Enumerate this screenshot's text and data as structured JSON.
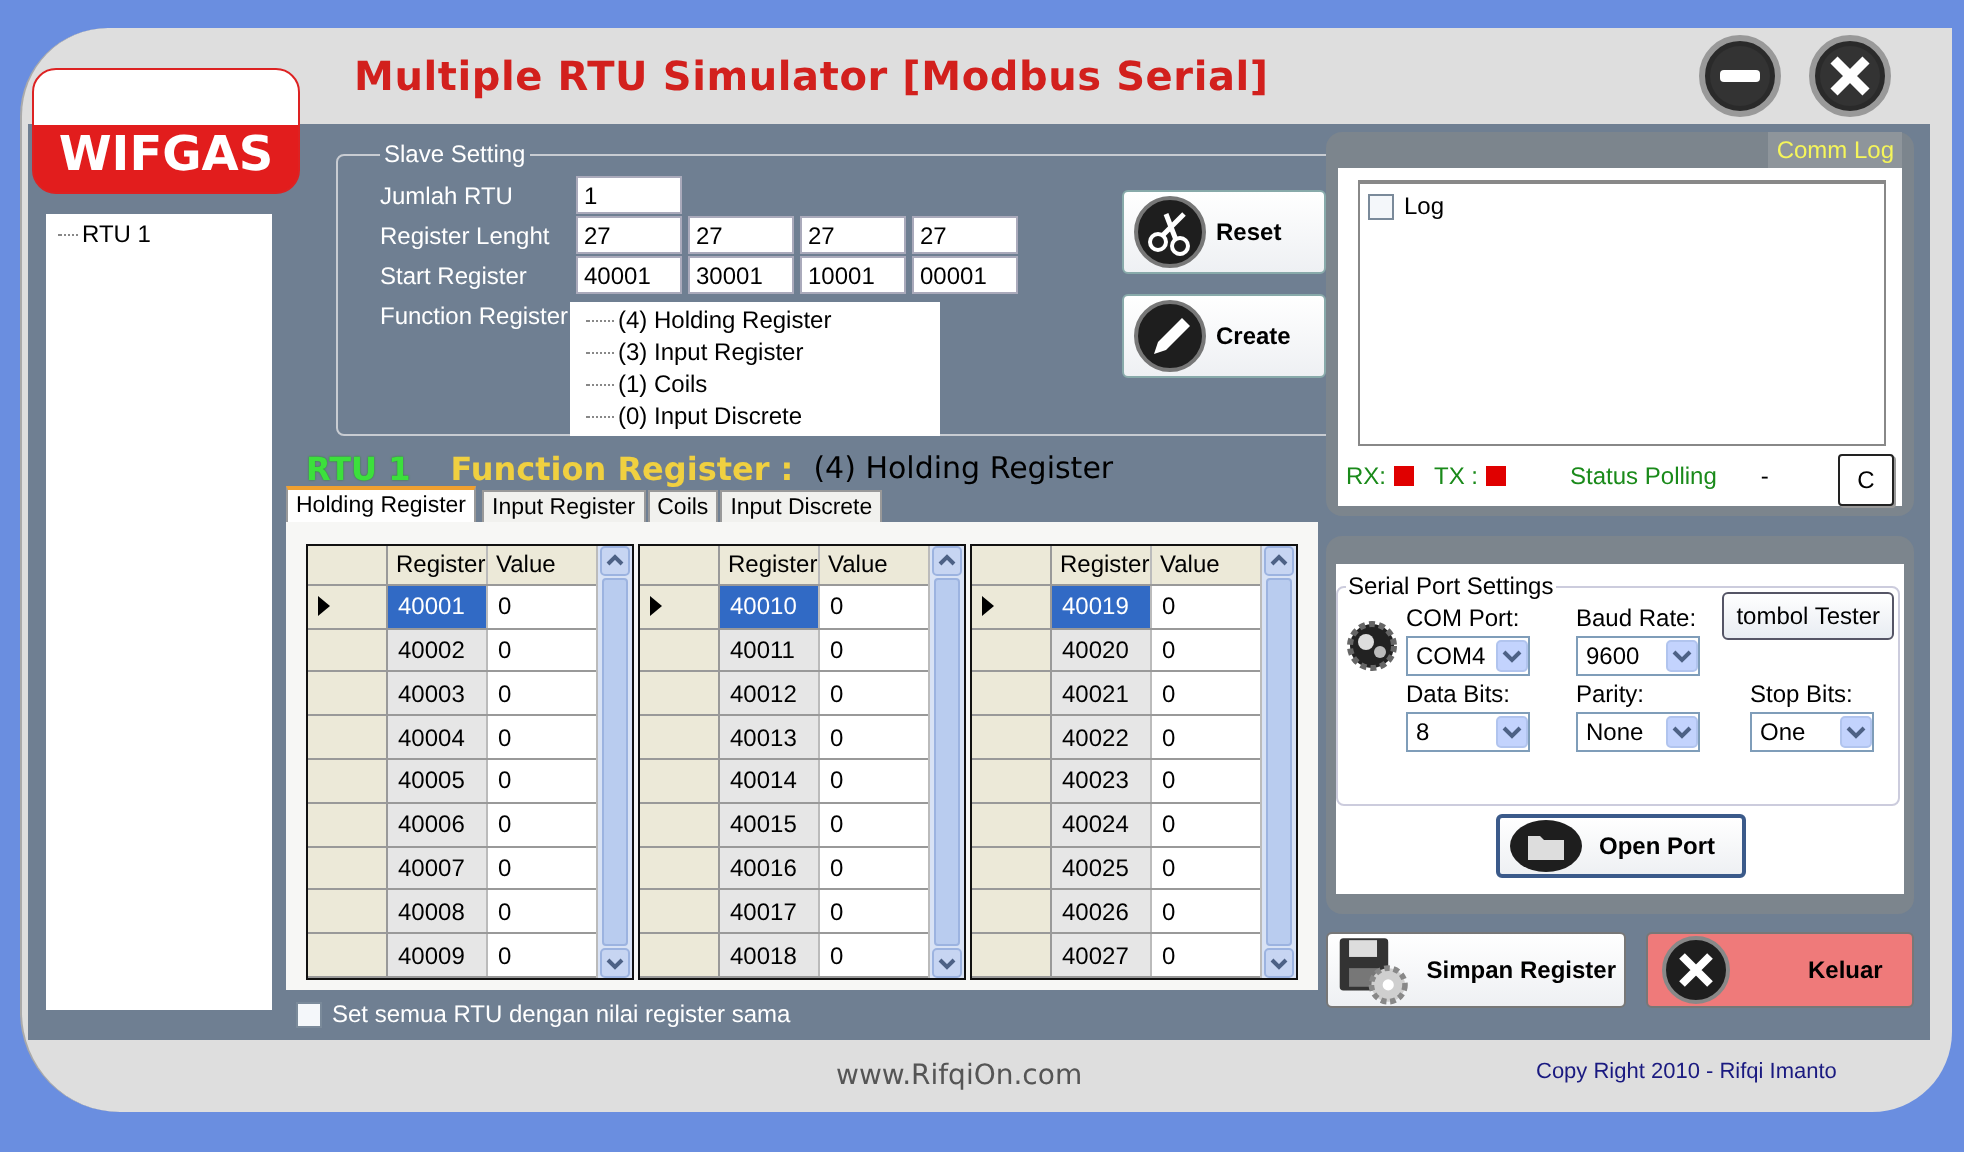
{
  "window": {
    "title": "Multiple RTU Simulator [Modbus Serial]",
    "logo": "WIFGAS"
  },
  "tree": {
    "items": [
      {
        "label": "RTU 1"
      }
    ]
  },
  "slave_setting": {
    "title": "Slave Setting",
    "jumlah_rtu": {
      "label": "Jumlah RTU",
      "value": "1"
    },
    "register_length": {
      "label": "Register Lenght",
      "values": [
        "27",
        "27",
        "27",
        "27"
      ]
    },
    "start_register": {
      "label": "Start Register",
      "values": [
        "40001",
        "30001",
        "10001",
        "00001"
      ]
    },
    "function_register": {
      "label": "Function Register",
      "items": [
        "(4) Holding Register",
        "(3) Input Register",
        "(1) Coils",
        "(0) Input Discrete"
      ]
    },
    "buttons": [
      {
        "label": "Reset",
        "kind": "reset"
      },
      {
        "label": "Create",
        "kind": "create"
      }
    ]
  },
  "function_header": {
    "rtu": "RTU 1",
    "label": "Function Register :",
    "value": "(4) Holding Register"
  },
  "tabs": [
    {
      "label": "Holding Register",
      "selected": true
    },
    {
      "label": "Input Register",
      "selected": false
    },
    {
      "label": "Coils",
      "selected": false
    },
    {
      "label": "Input Discrete",
      "selected": false
    }
  ],
  "grids": [
    {
      "columns": [
        "Register",
        "Value"
      ],
      "rows": [
        {
          "register": "40001",
          "value": "0",
          "selected": true
        },
        {
          "register": "40002",
          "value": "0",
          "selected": false
        },
        {
          "register": "40003",
          "value": "0",
          "selected": false
        },
        {
          "register": "40004",
          "value": "0",
          "selected": false
        },
        {
          "register": "40005",
          "value": "0",
          "selected": false
        },
        {
          "register": "40006",
          "value": "0",
          "selected": false
        },
        {
          "register": "40007",
          "value": "0",
          "selected": false
        },
        {
          "register": "40008",
          "value": "0",
          "selected": false
        },
        {
          "register": "40009",
          "value": "0",
          "selected": false
        }
      ]
    },
    {
      "columns": [
        "Register",
        "Value"
      ],
      "rows": [
        {
          "register": "40010",
          "value": "0",
          "selected": true
        },
        {
          "register": "40011",
          "value": "0",
          "selected": false
        },
        {
          "register": "40012",
          "value": "0",
          "selected": false
        },
        {
          "register": "40013",
          "value": "0",
          "selected": false
        },
        {
          "register": "40014",
          "value": "0",
          "selected": false
        },
        {
          "register": "40015",
          "value": "0",
          "selected": false
        },
        {
          "register": "40016",
          "value": "0",
          "selected": false
        },
        {
          "register": "40017",
          "value": "0",
          "selected": false
        },
        {
          "register": "40018",
          "value": "0",
          "selected": false
        }
      ]
    },
    {
      "columns": [
        "Register",
        "Value"
      ],
      "rows": [
        {
          "register": "40019",
          "value": "0",
          "selected": true
        },
        {
          "register": "40020",
          "value": "0",
          "selected": false
        },
        {
          "register": "40021",
          "value": "0",
          "selected": false
        },
        {
          "register": "40022",
          "value": "0",
          "selected": false
        },
        {
          "register": "40023",
          "value": "0",
          "selected": false
        },
        {
          "register": "40024",
          "value": "0",
          "selected": false
        },
        {
          "register": "40025",
          "value": "0",
          "selected": false
        },
        {
          "register": "40026",
          "value": "0",
          "selected": false
        },
        {
          "register": "40027",
          "value": "0",
          "selected": false
        }
      ]
    }
  ],
  "set_all": {
    "label": "Set semua RTU dengan nilai register sama",
    "checked": false
  },
  "comm_log": {
    "title": "Comm Log",
    "log": {
      "label": "Log",
      "checked": false
    },
    "rx": {
      "label": "RX:",
      "color": "#e00000"
    },
    "tx": {
      "label": "TX :",
      "color": "#e00000"
    },
    "status_label": "Status Polling",
    "status_value": "-",
    "clear_button": "C"
  },
  "serial": {
    "title": "Serial Port Settings",
    "tester_button": "tombol Tester",
    "fields": [
      {
        "label": "COM Port:",
        "value": "COM4"
      },
      {
        "label": "Baud Rate:",
        "value": "9600"
      },
      {
        "label": "Data Bits:",
        "value": "8"
      },
      {
        "label": "Parity:",
        "value": "None"
      },
      {
        "label": "Stop Bits:",
        "value": "One"
      }
    ],
    "open_button": "Open Port"
  },
  "buttons": [
    {
      "label": "Simpan Register",
      "kind": "save"
    },
    {
      "label": "Keluar",
      "kind": "exit"
    }
  ],
  "website": "www.RifqiOn.com",
  "copyright": "Copy Right 2010 - Rifqi Imanto"
}
